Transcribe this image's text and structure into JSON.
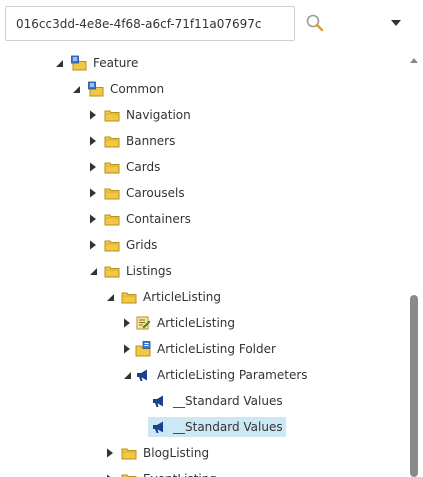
{
  "search": {
    "value": "016cc3dd-4e8e-4f68-a6cf-71f11a07697c"
  },
  "tree": [
    {
      "label": "Feature",
      "icon": "feature-folder-icon",
      "toggle": "expanded"
    },
    {
      "label": "Common",
      "icon": "feature-folder-icon",
      "toggle": "expanded"
    },
    {
      "label": "Navigation",
      "icon": "folder-icon",
      "toggle": "collapsed"
    },
    {
      "label": "Banners",
      "icon": "folder-icon",
      "toggle": "collapsed"
    },
    {
      "label": "Cards",
      "icon": "folder-icon",
      "toggle": "collapsed"
    },
    {
      "label": "Carousels",
      "icon": "folder-icon",
      "toggle": "collapsed"
    },
    {
      "label": "Containers",
      "icon": "folder-icon",
      "toggle": "collapsed"
    },
    {
      "label": "Grids",
      "icon": "folder-icon",
      "toggle": "collapsed"
    },
    {
      "label": "Listings",
      "icon": "folder-icon",
      "toggle": "expanded"
    },
    {
      "label": "ArticleListing",
      "icon": "folder-icon",
      "toggle": "expanded"
    },
    {
      "label": "ArticleListing",
      "icon": "template-icon",
      "toggle": "collapsed"
    },
    {
      "label": "ArticleListing Folder",
      "icon": "folder-template-icon",
      "toggle": "collapsed"
    },
    {
      "label": "ArticleListing Parameters",
      "icon": "megaphone-icon",
      "toggle": "expanded"
    },
    {
      "label": "__Standard Values",
      "icon": "megaphone-icon",
      "toggle": "none"
    },
    {
      "label": "__Standard Values",
      "icon": "megaphone-icon",
      "toggle": "none",
      "selected": true
    },
    {
      "label": "BlogListing",
      "icon": "folder-icon",
      "toggle": "collapsed"
    },
    {
      "label": "EventListing",
      "icon": "folder-icon",
      "toggle": "collapsed"
    }
  ],
  "colors": {
    "selection": "#cde8f5",
    "folder": "#f2c744",
    "scroll_thumb": "#8a8a8a"
  }
}
